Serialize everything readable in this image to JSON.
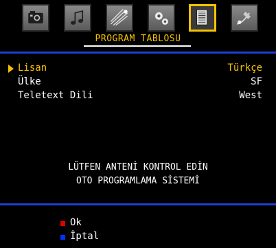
{
  "header": {
    "title": "PROGRAM TABLOSU",
    "tabs": [
      {
        "icon": "camera-icon",
        "selected": false
      },
      {
        "icon": "music-note-icon",
        "selected": false
      },
      {
        "icon": "meteor-icon",
        "selected": false
      },
      {
        "icon": "gears-icon",
        "selected": false
      },
      {
        "icon": "document-list-icon",
        "selected": true
      },
      {
        "icon": "satellite-icon",
        "selected": false
      }
    ]
  },
  "menu": [
    {
      "label": "Lisan",
      "value": "Türkçe"
    },
    {
      "label": "Ülke",
      "value": "SF"
    },
    {
      "label": "Teletext Dili",
      "value": "West"
    }
  ],
  "messages": {
    "line1": "LÜTFEN ANTENİ KONTROL EDİN",
    "line2": "OTO PROGRAMLAMA SİSTEMİ"
  },
  "footer": {
    "ok_label": "Ok",
    "cancel_label": "İptal",
    "ok_color": "#e00000",
    "cancel_color": "#0030ff"
  },
  "colors": {
    "accent": "#f5c200",
    "divider": "#1f3fd6"
  }
}
